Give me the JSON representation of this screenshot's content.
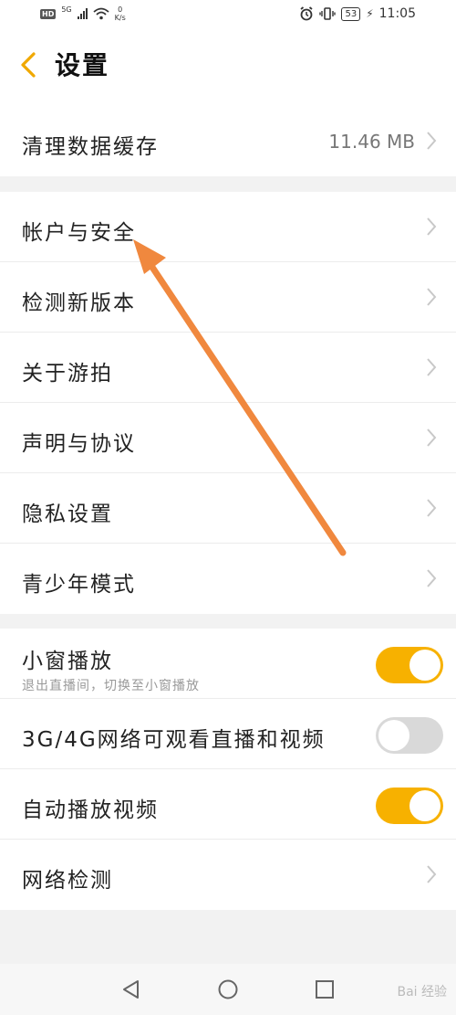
{
  "status_bar": {
    "hd": "HD",
    "signal": "5G",
    "speed_value": "0",
    "speed_unit": "K/s",
    "battery": "53",
    "time": "11:05"
  },
  "header": {
    "title": "设置"
  },
  "group_cache": [
    {
      "label": "清理数据缓存",
      "value": "11.46 MB"
    }
  ],
  "group_account": [
    {
      "label": "帐户与安全"
    },
    {
      "label": "检测新版本"
    },
    {
      "label": "关于游拍"
    },
    {
      "label": "声明与协议"
    },
    {
      "label": "隐私设置"
    },
    {
      "label": "青少年模式"
    }
  ],
  "group_playback": {
    "mini_window": {
      "label": "小窗播放",
      "sub": "退出直播间，切换至小窗播放",
      "on": true
    },
    "mobile_data": {
      "label": "3G/4G网络可观看直播和视频",
      "on": false
    },
    "autoplay": {
      "label": "自动播放视频",
      "on": true
    },
    "network_check": {
      "label": "网络检测"
    }
  },
  "watermark": "Bai 经验",
  "colors": {
    "accent": "#f7b100",
    "annotation_arrow": "#f0883e"
  }
}
